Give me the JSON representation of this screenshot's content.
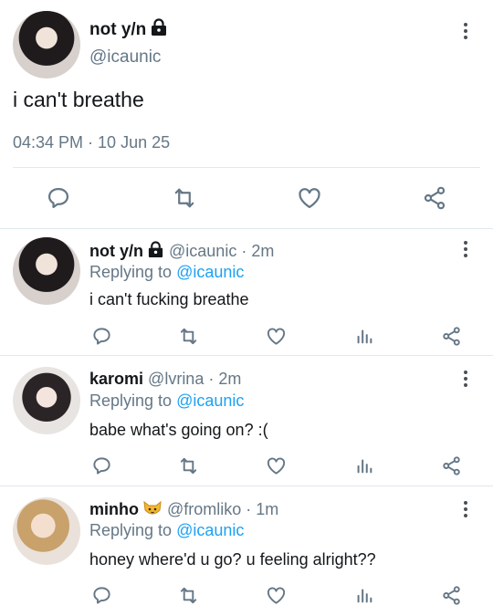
{
  "main_tweet": {
    "display_name": "not y/n",
    "handle": "@icaunic",
    "text": "i can't breathe",
    "timestamp": "04:34 PM · 10 Jun 25"
  },
  "replies": [
    {
      "display_name": "not y/n",
      "handle_time": "@icaunic · 2m",
      "replying_prefix": "Replying to ",
      "replying_handle": "@icaunic",
      "text": "i can't fucking breathe"
    },
    {
      "display_name": "karomi",
      "handle_time": "@lvrina · 2m",
      "replying_prefix": "Replying to ",
      "replying_handle": "@icaunic",
      "text": "babe what's going on? :("
    },
    {
      "display_name": "minho",
      "handle_time": "@fromliko · 1m",
      "replying_prefix": "Replying to ",
      "replying_handle": "@icaunic",
      "text": "honey where'd u go? u feeling alright??"
    }
  ],
  "icons": {
    "reply": "reply-icon",
    "retweet": "retweet-icon",
    "like": "heart-icon",
    "analytics": "analytics-icon",
    "share": "share-icon",
    "more": "more-vertical-icon",
    "lock": "lock-icon",
    "cat": "cat-emoji-icon"
  },
  "colors": {
    "text": "#14171a",
    "secondary": "#657786",
    "link": "#1da1f2",
    "icon": "#657786",
    "divider": "#e1e8ed"
  }
}
